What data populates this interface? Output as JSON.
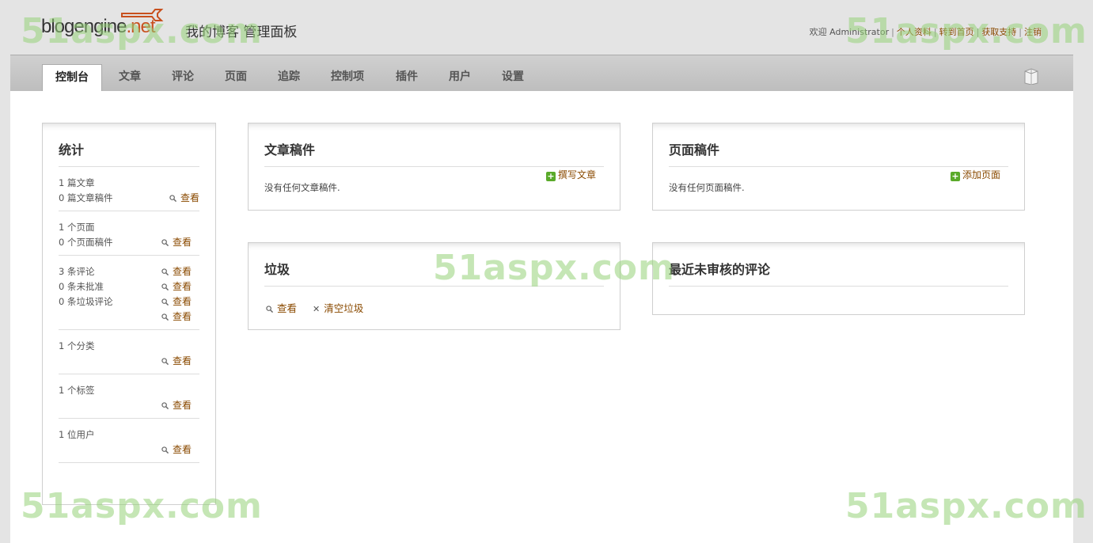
{
  "header": {
    "logo_main": "blogengine",
    "logo_suffix": ".net",
    "site_title": "我的博客  管理面板",
    "welcome": "欢迎",
    "username": "Administrator",
    "links": [
      "个人资料",
      "转到首页",
      "获取支持",
      "注销"
    ]
  },
  "tabs": [
    "控制台",
    "文章",
    "评论",
    "页面",
    "追踪",
    "控制项",
    "插件",
    "用户",
    "设置"
  ],
  "active_tab": "控制台",
  "stats": {
    "title": "统计",
    "view_label": "查看",
    "groups": [
      {
        "lines": [
          "1 篇文章",
          "0 篇文章稿件"
        ]
      },
      {
        "lines": [
          "1 个页面",
          "0 个页面稿件"
        ]
      },
      {
        "lines": [
          "3 条评论",
          "0 条未批准",
          "0 条垃圾评论"
        ]
      },
      {
        "lines": [
          "1 个分类"
        ]
      },
      {
        "lines": [
          "1 个标签"
        ]
      },
      {
        "lines": [
          "1 位用户"
        ]
      }
    ]
  },
  "post_drafts": {
    "title": "文章稿件",
    "action": "撰写文章",
    "empty": "没有任何文章稿件."
  },
  "page_drafts": {
    "title": "页面稿件",
    "action": "添加页面",
    "empty": "没有任何页面稿件."
  },
  "trash": {
    "title": "垃圾",
    "view": "查看",
    "empty": "清空垃圾"
  },
  "pending_comments": {
    "title": "最近未审核的评论"
  },
  "watermark": "51aspx.com",
  "colors": {
    "link": "#8a4a00",
    "tabbar": "#c4c4c4",
    "add_icon": "#5aaa2a"
  }
}
